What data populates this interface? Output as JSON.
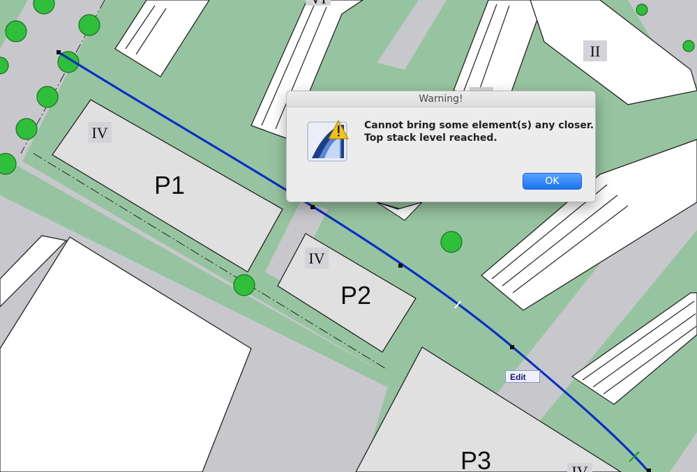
{
  "plan": {
    "labels": {
      "p1": "P1",
      "p2": "P2",
      "p3": "P3",
      "story_p1": "IV",
      "story_p2": "IV",
      "story_p3": "IV",
      "story_top_right": "II",
      "story_top": "VI"
    },
    "colors": {
      "green_area": "#97c4a0",
      "road": "#c8c8cc",
      "building": "#e0e0e0",
      "white_block": "#ffffff",
      "tree": "#2fbf3a",
      "spline": "#0a2fc6"
    }
  },
  "tooltip": {
    "edit": "Edit"
  },
  "dialog": {
    "title": "Warning!",
    "message_line1": "Cannot bring some element(s) any closer.",
    "message_line2": "Top stack level reached.",
    "ok_label": "OK",
    "icon": "archicad-warning-icon"
  }
}
